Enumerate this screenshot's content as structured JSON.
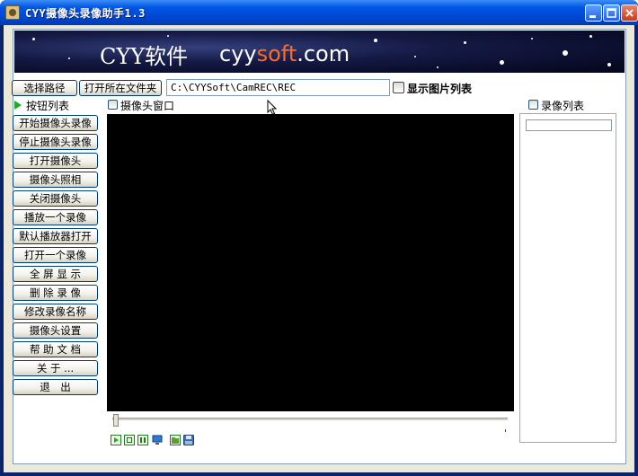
{
  "window": {
    "title": "CYY摄像头录像助手1.3"
  },
  "banner": {
    "logo_text": "CYY软件",
    "domain_prefix": "cyy",
    "domain_highlight": "soft",
    "domain_suffix": ".com"
  },
  "toolbar": {
    "choose_path_label": "选择路径",
    "open_folder_label": "打开所在文件夹",
    "path_value": "C:\\CYYSoft\\CamREC\\REC",
    "show_images_label": "显示图片列表"
  },
  "sidebar": {
    "header": "按钮列表",
    "buttons": [
      "开始摄像头录像",
      "停止摄像头录像",
      "打开摄像头",
      "摄像头照相",
      "关闭摄像头",
      "播放一个录像",
      "默认播放器打开",
      "打开一个录像",
      "全 屏 显 示",
      "删 除 录 像",
      "修改录像名称",
      "摄像头设置",
      "帮 助 文 档",
      "关 于 ...",
      "退　出"
    ]
  },
  "camera": {
    "window_label": "摄像头窗口"
  },
  "recordings": {
    "header": "录像列表"
  },
  "colors": {
    "title_bar": "#0055e5",
    "banner_accent": "#ff6b24",
    "video_bg": "#000000",
    "play_icon": "#1faa27"
  }
}
